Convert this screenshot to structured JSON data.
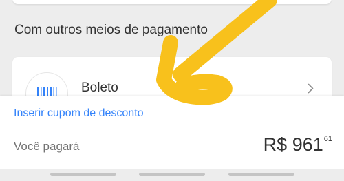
{
  "section": {
    "title": "Com outros meios de pagamento"
  },
  "options": [
    {
      "label": "Boleto",
      "icon": "barcode-icon"
    }
  ],
  "bottom_sheet": {
    "coupon_link": "Inserir cupom de desconto",
    "pay_label": "Você pagará",
    "price_main": "R$ 961",
    "price_cents": "61"
  },
  "colors": {
    "background": "#ededed",
    "card": "#ffffff",
    "link": "#3483fa",
    "icon_blue": "#3483fa",
    "annotation": "#f8c11c"
  },
  "icons": {
    "chevron": "chevron-right-icon",
    "annotation": "yellow-arrow-annotation"
  }
}
